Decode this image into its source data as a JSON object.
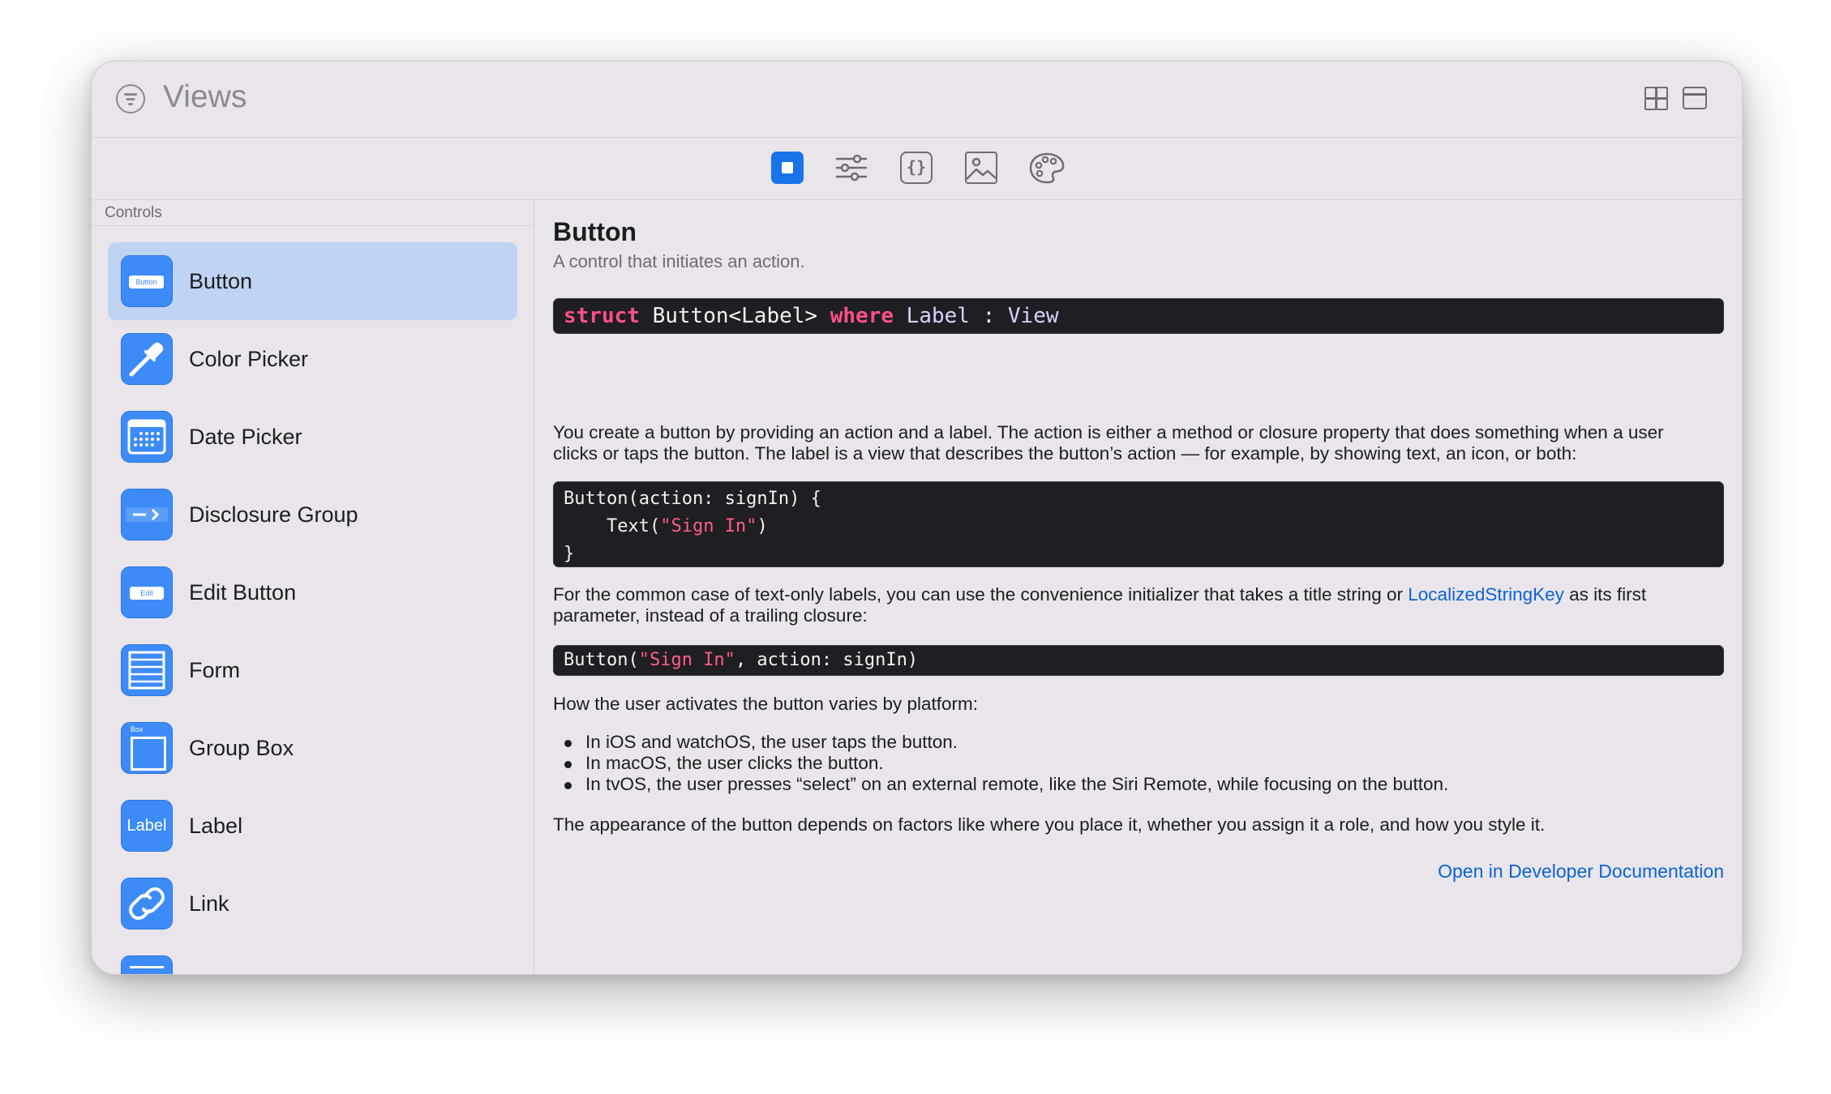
{
  "window": {
    "title": "Views"
  },
  "toolbar": {
    "tools": [
      "views-tab",
      "modifiers-tab",
      "code-snippets-tab",
      "images-tab",
      "colors-tab"
    ],
    "selected": "views-tab"
  },
  "sidebar": {
    "header": "Controls",
    "items": [
      {
        "label": "Button",
        "icon": "button-icon",
        "icon_text": "Button",
        "selected": true
      },
      {
        "label": "Color Picker",
        "icon": "eyedropper-icon"
      },
      {
        "label": "Date Picker",
        "icon": "calendar-icon"
      },
      {
        "label": "Disclosure Group",
        "icon": "disclosure-icon"
      },
      {
        "label": "Edit Button",
        "icon": "edit-button-icon",
        "icon_text": "Edit"
      },
      {
        "label": "Form",
        "icon": "form-icon"
      },
      {
        "label": "Group Box",
        "icon": "group-box-icon",
        "icon_text": "Box"
      },
      {
        "label": "Label",
        "icon": "label-icon",
        "icon_text": "Label"
      },
      {
        "label": "Link",
        "icon": "link-icon"
      }
    ]
  },
  "detail": {
    "title": "Button",
    "subtitle": "A control that initiates an action.",
    "declaration": {
      "kw1": "struct",
      "name": " Button<Label> ",
      "kw2": "where",
      "rest1": " Label",
      "colon": " : ",
      "rest2": "View"
    },
    "para1": "You create a button by providing an action and a label. The action is either a method or closure property that does something when a user clicks or taps the button. The label is a view that describes the button’s action — for example, by showing text, an icon, or both:",
    "code1": {
      "line1": "Button(action: signIn) {",
      "line2_pre": "    Text(",
      "line2_str": "\"Sign In\"",
      "line2_post": ")",
      "line3": "}"
    },
    "para2_pre": "For the common case of text-only labels, you can use the convenience initializer that takes a title string or ",
    "para2_link": "LocalizedStringKey",
    "para2_post": " as its first parameter, instead of a trailing closure:",
    "code2": {
      "pre": "Button(",
      "str": "\"Sign In\"",
      "post": ", action: signIn)"
    },
    "para3": "How the user activates the button varies by platform:",
    "bullets": [
      "In iOS and watchOS, the user taps the button.",
      "In macOS, the user clicks the button.",
      "In tvOS, the user presses “select” on an external remote, like the Siri Remote, while focusing on the button."
    ],
    "para4": "The appearance of the button depends on factors like where you place it, whether you assign it a role, and how you style it.",
    "open_link": "Open in Developer Documentation"
  },
  "colors": {
    "accent": "#1a73e8",
    "selection": "#bfd3f2",
    "code_bg": "#1f1e22",
    "keyword": "#ff4f8b",
    "link": "#0b63d6"
  }
}
